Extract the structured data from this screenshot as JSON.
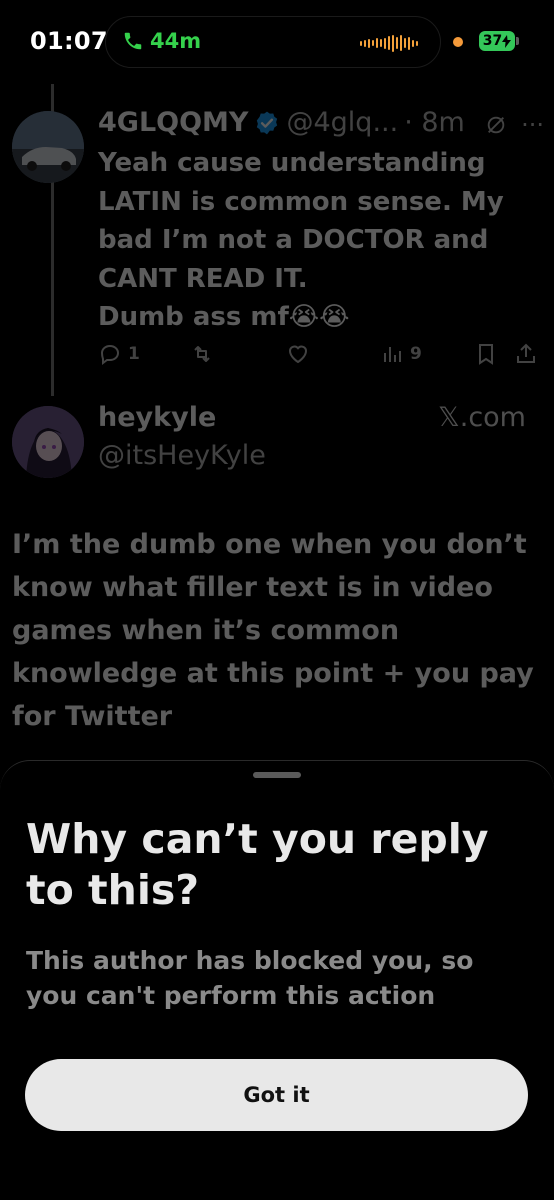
{
  "status_bar": {
    "time": "01:07",
    "call_duration": "44m",
    "battery": "37"
  },
  "tweet": {
    "display_name": "4GLQQMY",
    "handle": "@4glq...",
    "time": "· 8m",
    "text": "Yeah cause understanding LATIN is common sense. My bad I’m not a DOCTOR and CANT READ IT.\nDumb ass mf😭😭",
    "replies": "1",
    "views": "9",
    "more": "···"
  },
  "quoted": {
    "display_name": "heykyle",
    "handle": "@itsHeyKyle",
    "source": "𝕏.com",
    "text": "I’m the dumb one when you don’t know what filler text is in video games when it’s common knowledge at this point + you pay for Twitter"
  },
  "sheet": {
    "title": "Why can’t you reply to this?",
    "body": "This author has blocked you, so you can't perform this action",
    "button": "Got it"
  },
  "colors": {
    "accent_green": "#35d14c",
    "verified_blue": "#1d9bf0",
    "sheet_background": "#000000"
  }
}
